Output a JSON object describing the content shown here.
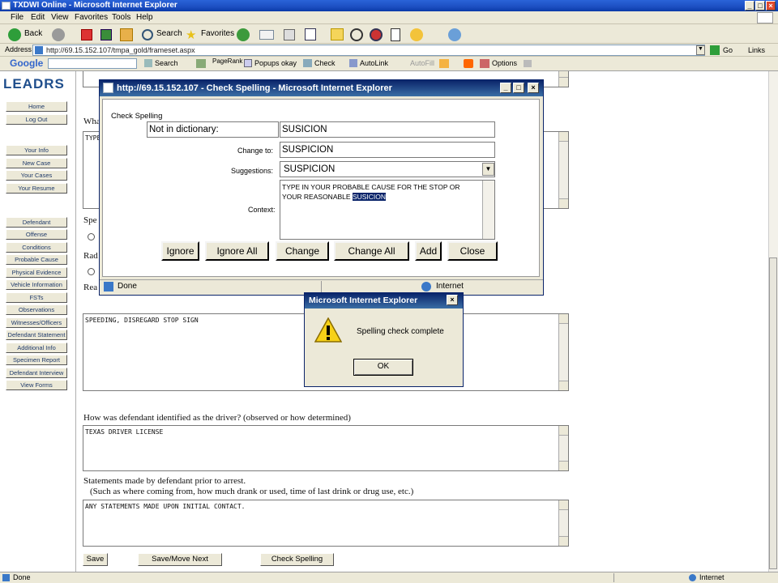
{
  "window": {
    "title": "TXDWI Online - Microsoft Internet Explorer"
  },
  "menu": [
    "File",
    "Edit",
    "View",
    "Favorites",
    "Tools",
    "Help"
  ],
  "toolbar": {
    "back": "Back",
    "search": "Search",
    "favorites": "Favorites"
  },
  "address": {
    "label": "Address",
    "url": "http://69.15.152.107/tmpa_gold/frameset.aspx",
    "go": "Go",
    "links": "Links"
  },
  "google_bar": {
    "brand": "Google",
    "search": "Search",
    "pagerank": "PageRank",
    "popups": "Popups okay",
    "check": "Check",
    "autolink": "AutoLink",
    "autofill": "AutoFill",
    "options": "Options"
  },
  "sidebar": {
    "logo": "LEADRS",
    "group1": [
      "Home",
      "Log Out"
    ],
    "group2": [
      "Your Info",
      "New Case",
      "Your Cases",
      "Your Resume"
    ],
    "group3": [
      "Defendant",
      "Offense",
      "Conditions",
      "Probable Cause",
      "Physical Evidence",
      "Vehicle Information",
      "FSTs",
      "Observations",
      "Witnesses/Officers",
      "Defendant Statement",
      "Additional Info",
      "Specimen Report",
      "Defendant Interview",
      "View Forms"
    ]
  },
  "form": {
    "top_textarea": "TYPE",
    "q_what": "Wha",
    "q_spe": "Spe",
    "q_rad": "Rad",
    "q_rea": "Rea",
    "reason_text": "SPEEDING, DISREGARD STOP SIGN",
    "q_identified": "How was defendant identified as the driver? (observed or how determined)",
    "identified_text": "TEXAS DRIVER LICENSE",
    "q_statements": "Statements made by defendant prior to arrest.",
    "q_statements_hint": "(Such as where coming from, how much drank or used, time of last drink or drug use, etc.)",
    "statements_text": "ANY STATEMENTS MADE UPON INITIAL CONTACT.",
    "buttons": {
      "save": "Save",
      "save_next": "Save/Move Next",
      "spell": "Check Spelling"
    }
  },
  "spell_dialog": {
    "title": "http://69.15.152.107 - Check Spelling - Microsoft Internet Explorer",
    "heading": "Check Spelling",
    "not_in_dict_label": "Not in dictionary:",
    "not_in_dict_value": "SUSICION",
    "change_to_label": "Change to:",
    "change_to_value": "SUSPICION",
    "suggestions_label": "Suggestions:",
    "suggestion_value": "SUSPICION",
    "context_label": "Context:",
    "context_text": "TYPE IN YOUR PROBABLE CAUSE FOR THE STOP OR YOUR REASONABLE",
    "context_highlight": "SUSICION",
    "buttons": {
      "ignore": "Ignore",
      "ignore_all": "Ignore All",
      "change": "Change",
      "change_all": "Change All",
      "add": "Add",
      "close": "Close"
    },
    "status": "Done",
    "zone": "Internet"
  },
  "alert": {
    "title": "Microsoft Internet Explorer",
    "message": "Spelling check complete",
    "ok": "OK"
  },
  "status": {
    "text": "Done",
    "zone": "Internet"
  }
}
